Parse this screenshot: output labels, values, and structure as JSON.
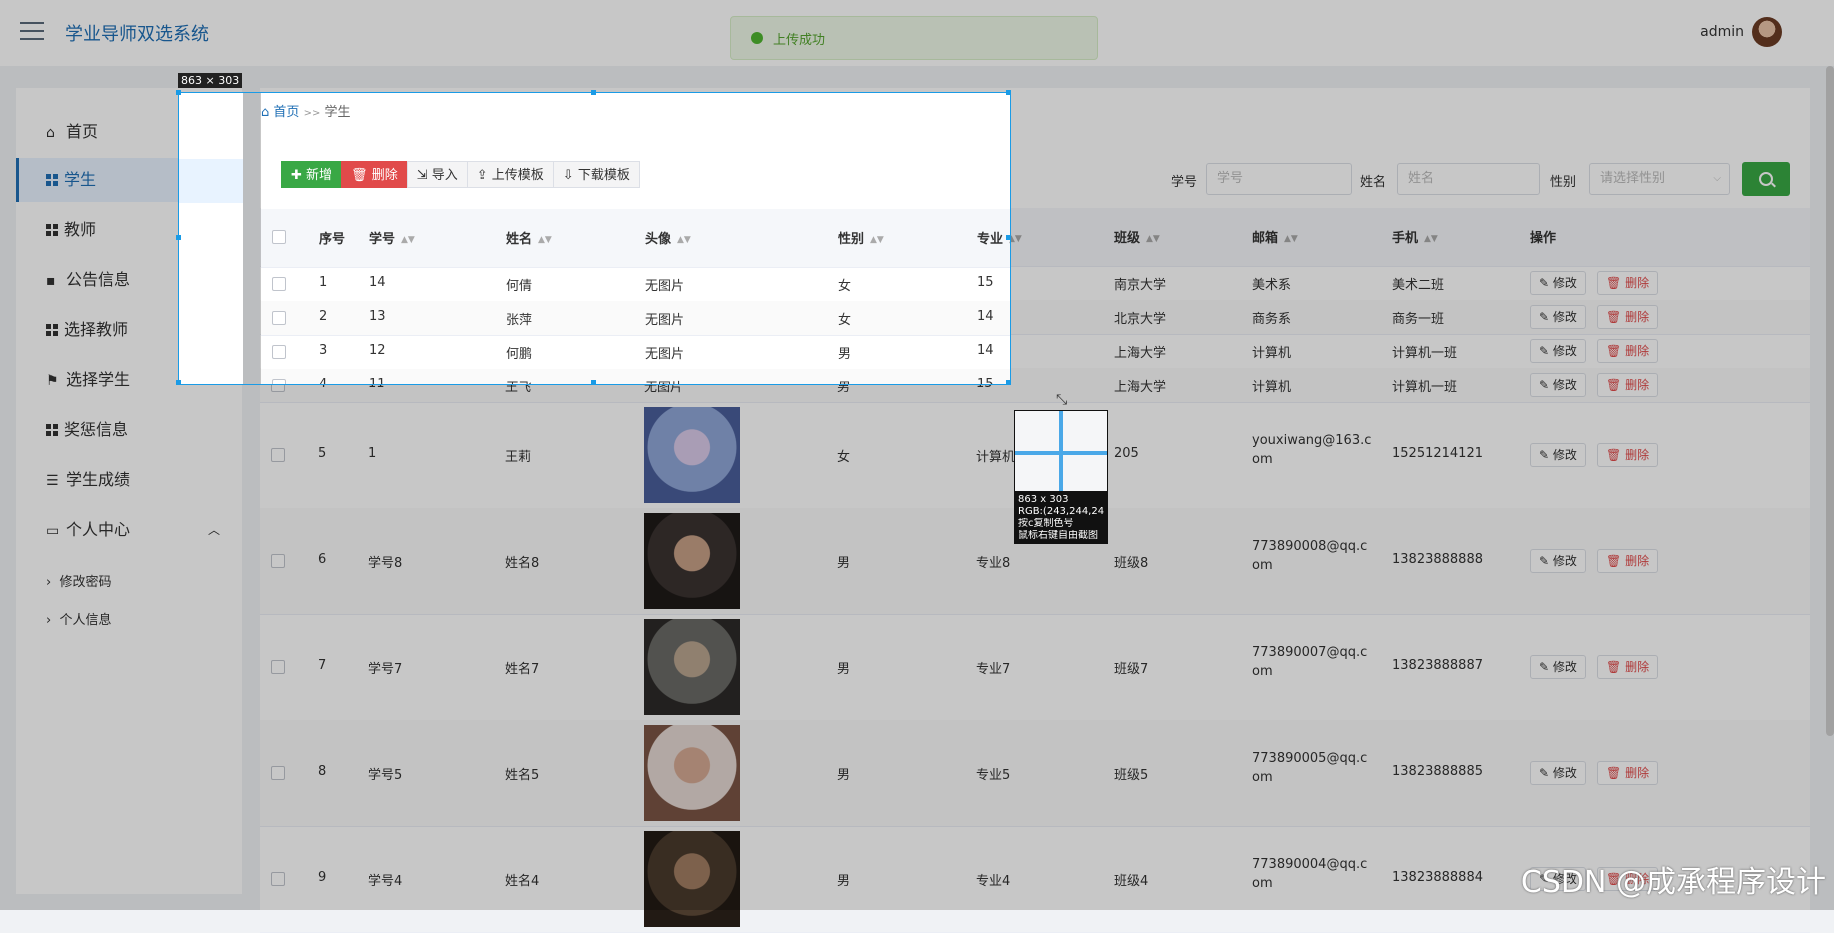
{
  "header": {
    "app_title": "学业导师双选系统",
    "toast": "上传成功",
    "user": "admin"
  },
  "sidebar": {
    "items": [
      {
        "label": "首页",
        "icon": "home-icon"
      },
      {
        "label": "学生",
        "icon": "grid-icon",
        "active": true
      },
      {
        "label": "教师",
        "icon": "grid-icon"
      },
      {
        "label": "公告信息",
        "icon": "message-icon"
      },
      {
        "label": "选择教师",
        "icon": "grid-icon"
      },
      {
        "label": "选择学生",
        "icon": "flag-icon"
      },
      {
        "label": "奖惩信息",
        "icon": "grid-icon"
      },
      {
        "label": "学生成绩",
        "icon": "sliders-icon"
      },
      {
        "label": "个人中心",
        "icon": "id-card-icon"
      }
    ],
    "sub_items": [
      "修改密码",
      "个人信息"
    ]
  },
  "breadcrumb": {
    "home": "首页",
    "sep": ">>",
    "current": "学生"
  },
  "toolbar": {
    "add": "新增",
    "delete": "删除",
    "import": "导入",
    "upload": "上传模板",
    "download": "下载模板"
  },
  "search": {
    "sno_label": "学号",
    "sno_placeholder": "学号",
    "name_label": "姓名",
    "name_placeholder": "姓名",
    "sex_label": "性别",
    "sex_placeholder": "请选择性别"
  },
  "table": {
    "columns": [
      "序号",
      "学号",
      "姓名",
      "头像",
      "性别",
      "专业",
      "班级",
      "邮箱",
      "手机",
      "操作"
    ],
    "rows": [
      {
        "idx": "1",
        "sno": "14",
        "name": "何倩",
        "photo": "无图片",
        "sex": "女",
        "major": "15",
        "cls": "南京大学",
        "email": "美术系",
        "phone": "美术二班"
      },
      {
        "idx": "2",
        "sno": "13",
        "name": "张萍",
        "photo": "无图片",
        "sex": "女",
        "major": "14",
        "cls": "北京大学",
        "email": "商务系",
        "phone": "商务一班"
      },
      {
        "idx": "3",
        "sno": "12",
        "name": "何鹏",
        "photo": "无图片",
        "sex": "男",
        "major": "14",
        "cls": "上海大学",
        "email": "计算机",
        "phone": "计算机一班"
      },
      {
        "idx": "4",
        "sno": "11",
        "name": "王飞",
        "photo": "无图片",
        "sex": "男",
        "major": "15",
        "cls": "上海大学",
        "email": "计算机",
        "phone": "计算机一班"
      },
      {
        "idx": "5",
        "sno": "1",
        "name": "王莉",
        "photo": "",
        "sex": "女",
        "major": "计算机",
        "cls": "205",
        "email1": "youxiwang@163.c",
        "email2": "om",
        "phone": "15251214121"
      },
      {
        "idx": "6",
        "sno": "学号8",
        "name": "姓名8",
        "photo": "",
        "sex": "男",
        "major": "专业8",
        "cls": "班级8",
        "email1": "773890008@qq.c",
        "email2": "om",
        "phone": "13823888888"
      },
      {
        "idx": "7",
        "sno": "学号7",
        "name": "姓名7",
        "photo": "",
        "sex": "男",
        "major": "专业7",
        "cls": "班级7",
        "email1": "773890007@qq.c",
        "email2": "om",
        "phone": "13823888887"
      },
      {
        "idx": "8",
        "sno": "学号5",
        "name": "姓名5",
        "photo": "",
        "sex": "男",
        "major": "专业5",
        "cls": "班级5",
        "email1": "773890005@qq.c",
        "email2": "om",
        "phone": "13823888885"
      },
      {
        "idx": "9",
        "sno": "学号4",
        "name": "姓名4",
        "photo": "",
        "sex": "男",
        "major": "专业4",
        "cls": "班级4",
        "email1": "773890004@qq.c",
        "email2": "om",
        "phone": "13823888884"
      }
    ],
    "edit_label": "修改",
    "remove_label": "删除"
  },
  "capture": {
    "size": "863 × 303",
    "mag_size": "863 x 303",
    "mag_rgb": "RGB:(243,244,24",
    "mag_hint1": "按c复制色号",
    "mag_hint2": "鼠标右键自由截图"
  },
  "watermark": "CSDN @成承程序设计",
  "colors": {
    "accent": "#1f6fb5",
    "green": "#39a845",
    "red": "#e14a4a",
    "capture": "#1a9be6"
  }
}
